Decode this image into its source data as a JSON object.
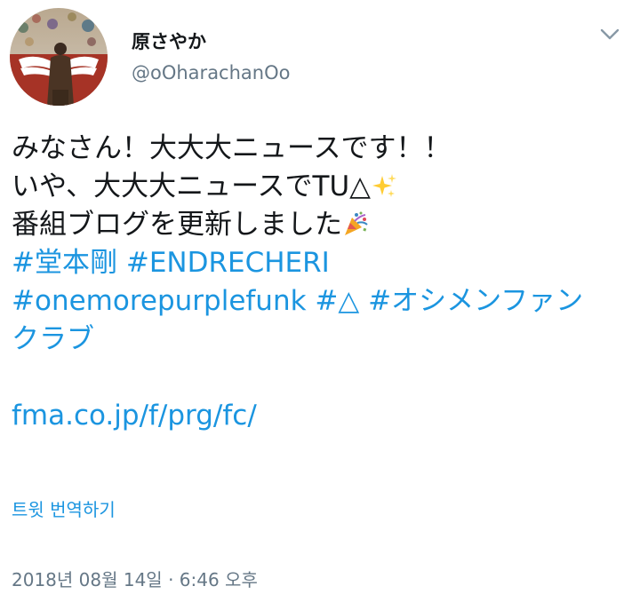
{
  "user": {
    "display_name": "原さやか",
    "handle": "@oOharachanOo"
  },
  "tweet": {
    "line1": "みなさん！大大大ニュースです！！",
    "line2_text": "いや、大大大ニュースでTU△",
    "line2_emoji": "sparkles-emoji",
    "line3_text": "番組ブログを更新しました",
    "line3_emoji": "party-popper-emoji",
    "hashtags": {
      "h1": "#堂本剛",
      "h2": "#ENDRECHERI",
      "h3": "#onemorepurplefunk",
      "h4": "#△",
      "h5a": "#オシメンファン",
      "h5b": "クラブ"
    },
    "link": "fma.co.jp/f/prg/fc/"
  },
  "translate_label": "트윗 번역하기",
  "timestamp": "2018년 08월 14일 · 6:46 오후",
  "colors": {
    "link": "#1b95e0",
    "secondary": "#657786",
    "text": "#14171a"
  },
  "icons": {
    "menu": "chevron-down-icon"
  }
}
